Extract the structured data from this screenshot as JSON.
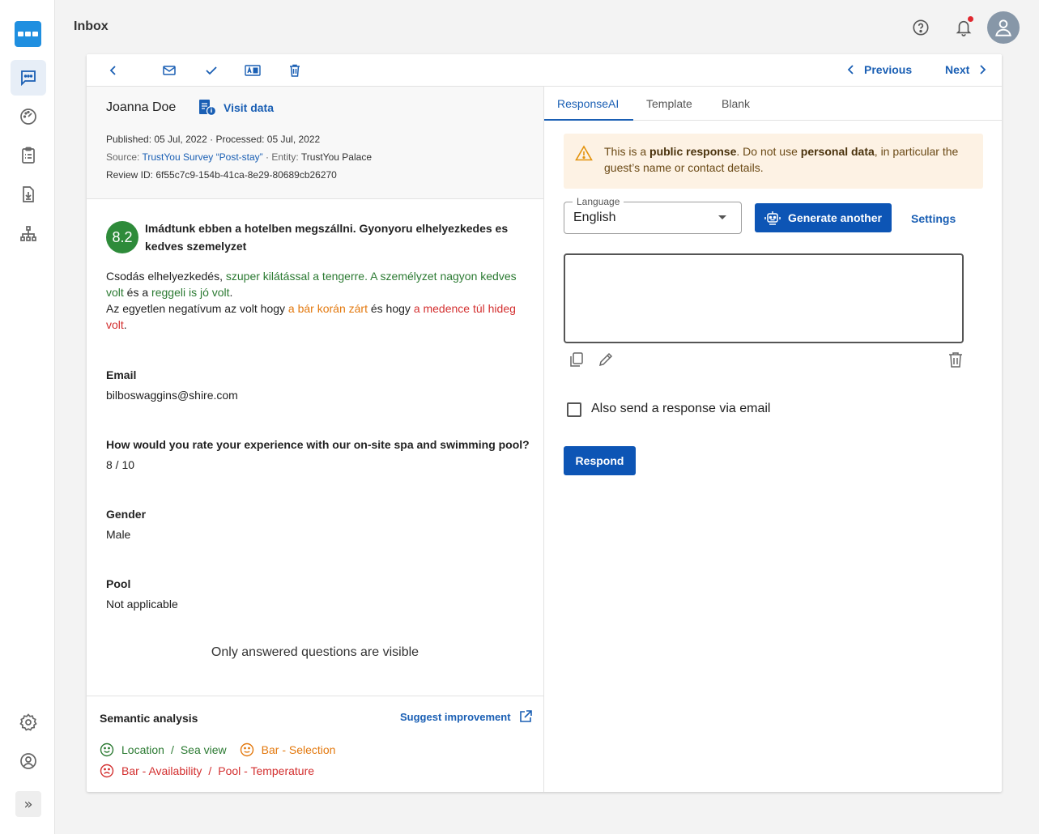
{
  "header": {
    "title": "Inbox"
  },
  "toolbar": {
    "previous_label": "Previous",
    "next_label": "Next"
  },
  "review": {
    "guest_name": "Joanna Doe",
    "visit_data_label": "Visit data",
    "published": "Published: 05 Jul, 2022",
    "processed": "Processed: 05 Jul, 2022",
    "source_label": "Source:",
    "source_value": "TrustYou Survey “Post-stay”",
    "entity_label": "Entity:",
    "entity_value": "TrustYou Palace",
    "review_id": "Review ID: 6f55c7c9-154b-41ca-8e29-80689cb26270",
    "score": "8.2",
    "title": "Imádtunk ebben a hotelben megszállni. Gyonyoru elhelyezkedes es kedves szemelyzet",
    "body": {
      "p1_a": "Csodás elhelyezkedés, ",
      "p1_b": "szuper kilátással a tengerre. A személyzet nagyon kedves volt",
      "p1_c": " és a ",
      "p1_d": "reggeli is jó volt",
      "p1_e": ".",
      "p2_a": "Az egyetlen negatívum az volt hogy ",
      "p2_b": "a bár korán zárt",
      "p2_c": " és hogy ",
      "p2_d": "a medence túl hideg volt",
      "p2_e": "."
    }
  },
  "answers": [
    {
      "label": "Email",
      "value": "bilboswaggins@shire.com"
    },
    {
      "label": "How would you rate your experience with our on-site spa and swimming pool?",
      "value": "8 / 10"
    },
    {
      "label": "Gender",
      "value": "Male"
    },
    {
      "label": "Pool",
      "value": "Not applicable"
    }
  ],
  "only_answered_note": "Only answered questions are visible",
  "semantic": {
    "title": "Semantic analysis",
    "suggest_label": "Suggest improvement",
    "positive": {
      "a": "Location",
      "b": "Sea view"
    },
    "neutral": {
      "a": "Bar - Selection"
    },
    "negative": {
      "a": "Bar - Availability",
      "b": "Pool - Temperature"
    },
    "separator": "/",
    "colors": {
      "positive": "#2b7a32",
      "neutral": "#e3780d",
      "negative": "#d32f2f"
    }
  },
  "response": {
    "tabs": [
      "ResponseAI",
      "Template",
      "Blank"
    ],
    "alert": {
      "t1": "This is a ",
      "t2": "public response",
      "t3": ". Do not use ",
      "t4": "personal data",
      "t5": ", in particular the guest’s name or contact details."
    },
    "language_label": "Language",
    "language_value": "English",
    "generate_label": "Generate another",
    "settings_label": "Settings",
    "response_text": "",
    "email_checkbox_label": "Also send a response via email",
    "respond_label": "Respond"
  },
  "icons": {
    "rail": [
      "logo-icon",
      "chat-icon",
      "dashboard-icon",
      "clipboard-icon",
      "download-icon",
      "sitemap-icon",
      "settings-icon",
      "user-icon",
      "double-chevron-right-icon"
    ],
    "top": [
      "help-icon",
      "bell-icon",
      "avatar-icon"
    ]
  },
  "accent_color": "#0d55b5"
}
